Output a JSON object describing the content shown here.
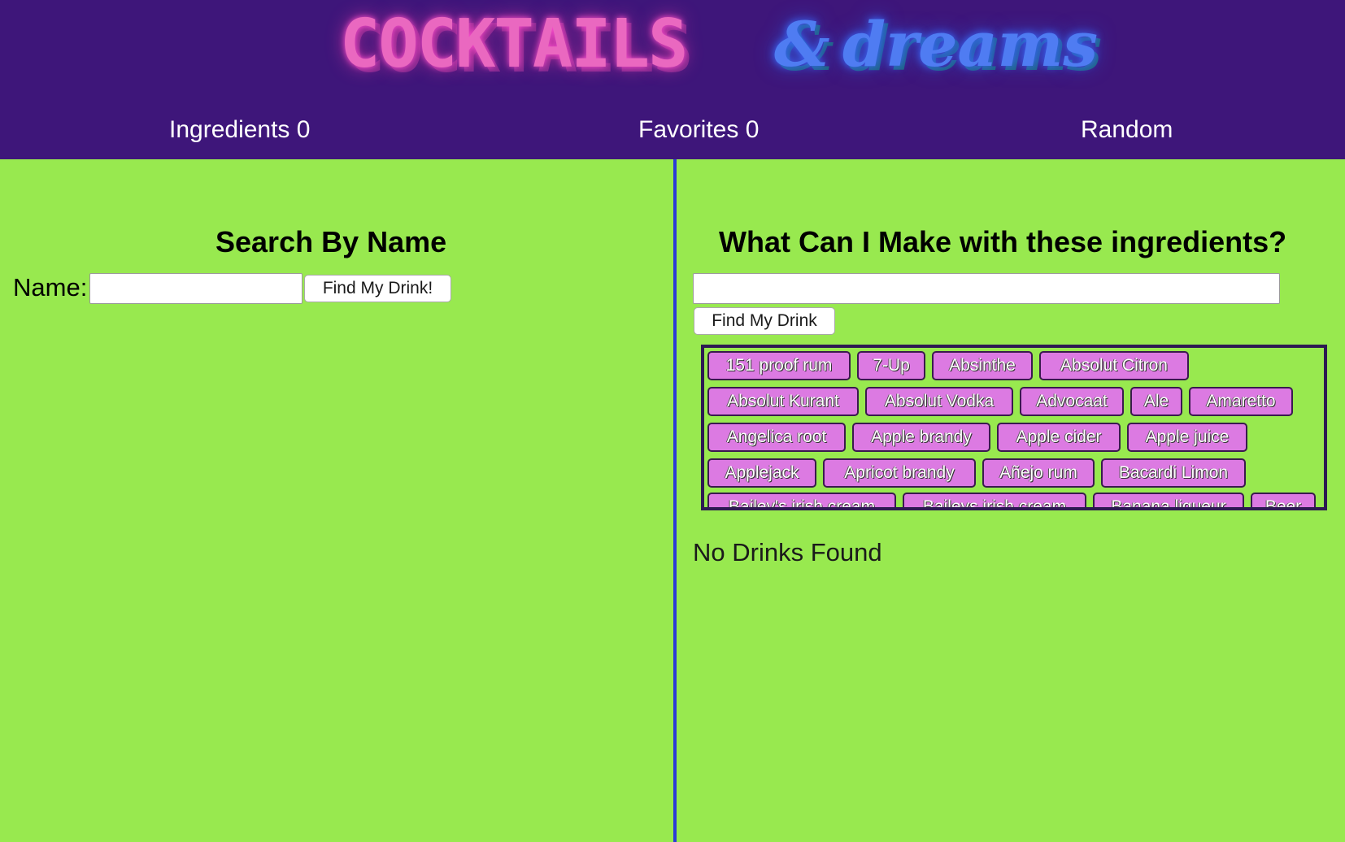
{
  "header": {
    "logo_word_1": "COCKTAILS",
    "logo_amp": "&",
    "logo_word_2": "dreams",
    "nav": {
      "ingredients": "Ingredients 0",
      "favorites": "Favorites 0",
      "random": "Random"
    }
  },
  "search_by_name": {
    "title": "Search By Name",
    "name_label": "Name:",
    "name_value": "",
    "button_label": "Find My Drink!"
  },
  "search_by_ingredients": {
    "title": "What Can I Make with these ingredients?",
    "input_value": "",
    "button_label": "Find My Drink",
    "ingredients": [
      [
        "151 proof rum",
        "7-Up",
        "Absinthe",
        "Absolut Citron"
      ],
      [
        "Absolut Kurant",
        "Absolut Vodka",
        "Advocaat",
        "Ale",
        "Amaretto"
      ],
      [
        "Angelica root",
        "Apple brandy",
        "Apple cider",
        "Apple juice"
      ],
      [
        "Applejack",
        "Apricot brandy",
        "Añejo rum",
        "Bacardi Limon"
      ],
      [
        "Bailey's irish cream",
        "Baileys irish cream",
        "Banana liqueur",
        "Beer"
      ]
    ],
    "result_text": "No Drinks Found"
  },
  "colors": {
    "header_bg": "#3e167a",
    "page_bg": "#98e94f",
    "divider": "#2b3bd8",
    "chip_bg": "#dc7ae2",
    "logo_pink": "#ea68c0",
    "logo_blue": "#4f7cf2"
  }
}
